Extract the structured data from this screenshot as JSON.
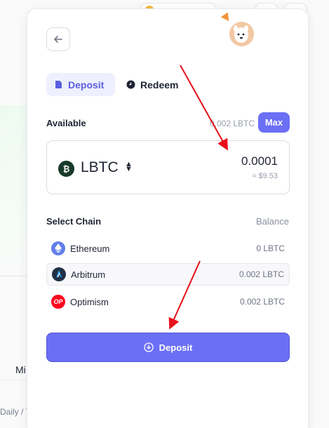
{
  "background": {
    "tab_label": "Mi",
    "footer_text": "Daily / T"
  },
  "modal": {
    "tabs": [
      {
        "label": "Deposit",
        "active": true,
        "icon": "document-icon"
      },
      {
        "label": "Redeem",
        "active": false,
        "icon": "clock-icon"
      }
    ],
    "available": {
      "label": "Available",
      "value": "0.002 LBTC",
      "max_label": "Max"
    },
    "amount": {
      "token": "LBTC",
      "token_icon": "bitcoin-icon",
      "value": "0.0001",
      "usd": "≈ $9.53"
    },
    "chains": {
      "title": "Select Chain",
      "balance_header": "Balance",
      "items": [
        {
          "name": "Ethereum",
          "balance": "0 LBTC",
          "icon": "ethereum-icon",
          "color": "#627eea",
          "selected": false
        },
        {
          "name": "Arbitrum",
          "balance": "0.002 LBTC",
          "icon": "arbitrum-icon",
          "color": "#213147",
          "selected": true
        },
        {
          "name": "Optimism",
          "balance": "0.002 LBTC",
          "icon": "optimism-icon",
          "color": "#ff0420",
          "selected": false
        }
      ]
    },
    "deposit_button": "Deposit"
  },
  "colors": {
    "accent": "#6b6ff5",
    "annotation_arrow": "#e8101a"
  }
}
